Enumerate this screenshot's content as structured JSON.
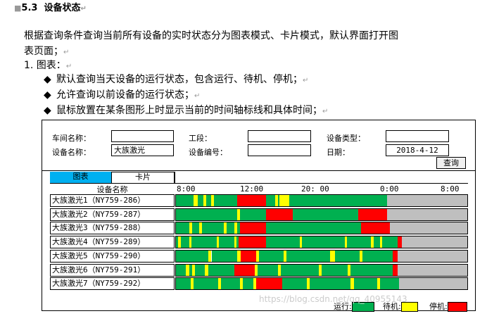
{
  "section": {
    "number": "5.3",
    "title": "设备状态"
  },
  "intro": "根据查询条件查询当前所有设备的实时状态分为图表模式、卡片模式，默认界面打开图",
  "intro2": "表页面；",
  "item1": "1. 图表：",
  "bullets": [
    "默认查询当天设备的运行状态，包含运行、待机、停机；",
    "允许查询以前设备的运行状态；",
    "鼠标放置在某条图形上时显示当前的时间轴标线和具体时间；"
  ],
  "form": {
    "workshop_label": "车间名称：",
    "workshop_value": "",
    "section_label": "工段：",
    "section_value": "",
    "type_label": "设备类型：",
    "type_value": "",
    "device_label": "设备名称：",
    "device_value": "大族激光",
    "code_label": "设备编号：",
    "code_value": "",
    "date_label": "日期：",
    "date_value": "2018-4-12",
    "query_label": "查询"
  },
  "tabs": {
    "chart": "图表",
    "card": "卡片"
  },
  "colors": {
    "running": "#00b050",
    "standby": "#ffff00",
    "stopped": "#ff0000",
    "idle": "#bfbfbf",
    "tab_active": "#00b0f0"
  },
  "chart_data": {
    "type": "timeline",
    "column_header": "设备名称",
    "time_ticks": [
      "8:00",
      "12:00",
      "20: 00",
      "0:00",
      "8:00"
    ],
    "legend": {
      "running": "运行:",
      "standby": "待机:",
      "stopped": "停机:"
    },
    "rows": [
      {
        "name": "大族激光1（NY759-286）",
        "segments": [
          {
            "s": "run",
            "f": 0,
            "t": 0.06
          },
          {
            "s": "stb",
            "f": 0.06,
            "t": 0.075
          },
          {
            "s": "run",
            "f": 0.075,
            "t": 0.095
          },
          {
            "s": "stb",
            "f": 0.095,
            "t": 0.105
          },
          {
            "s": "run",
            "f": 0.105,
            "t": 0.12
          },
          {
            "s": "stb",
            "f": 0.12,
            "t": 0.13
          },
          {
            "s": "run",
            "f": 0.13,
            "t": 0.21
          },
          {
            "s": "stp",
            "f": 0.21,
            "t": 0.31
          },
          {
            "s": "run",
            "f": 0.31,
            "t": 0.34
          },
          {
            "s": "stb",
            "f": 0.34,
            "t": 0.35
          },
          {
            "s": "run",
            "f": 0.35,
            "t": 0.355
          },
          {
            "s": "stb",
            "f": 0.355,
            "t": 0.39
          },
          {
            "s": "run",
            "f": 0.39,
            "t": 0.725
          },
          {
            "s": "idle",
            "f": 0.725,
            "t": 1
          }
        ]
      },
      {
        "name": "大族激光2（NY759-287）",
        "segments": [
          {
            "s": "run",
            "f": 0,
            "t": 0.21
          },
          {
            "s": "stb",
            "f": 0.21,
            "t": 0.22
          },
          {
            "s": "run",
            "f": 0.22,
            "t": 0.31
          },
          {
            "s": "stp",
            "f": 0.31,
            "t": 0.4
          },
          {
            "s": "run",
            "f": 0.4,
            "t": 0.625
          },
          {
            "s": "stp",
            "f": 0.625,
            "t": 0.725
          },
          {
            "s": "idle",
            "f": 0.725,
            "t": 1
          }
        ]
      },
      {
        "name": "大族激光3（NY759-288）",
        "segments": [
          {
            "s": "run",
            "f": 0,
            "t": 0.045
          },
          {
            "s": "stb",
            "f": 0.045,
            "t": 0.055
          },
          {
            "s": "run",
            "f": 0.055,
            "t": 0.08
          },
          {
            "s": "stb",
            "f": 0.08,
            "t": 0.09
          },
          {
            "s": "run",
            "f": 0.09,
            "t": 0.165
          },
          {
            "s": "stb",
            "f": 0.165,
            "t": 0.175
          },
          {
            "s": "run",
            "f": 0.175,
            "t": 0.2
          },
          {
            "s": "stb",
            "f": 0.2,
            "t": 0.21
          },
          {
            "s": "run",
            "f": 0.21,
            "t": 0.22
          },
          {
            "s": "stp",
            "f": 0.22,
            "t": 0.31
          },
          {
            "s": "run",
            "f": 0.31,
            "t": 0.635
          },
          {
            "s": "stp",
            "f": 0.635,
            "t": 0.735
          },
          {
            "s": "idle",
            "f": 0.735,
            "t": 1
          }
        ]
      },
      {
        "name": "大族激光4（NY759-289）",
        "segments": [
          {
            "s": "run",
            "f": 0,
            "t": 0.008
          },
          {
            "s": "stb",
            "f": 0.008,
            "t": 0.016
          },
          {
            "s": "run",
            "f": 0.016,
            "t": 0.045
          },
          {
            "s": "stb",
            "f": 0.045,
            "t": 0.053
          },
          {
            "s": "run",
            "f": 0.053,
            "t": 0.14
          },
          {
            "s": "stb",
            "f": 0.14,
            "t": 0.148
          },
          {
            "s": "run",
            "f": 0.148,
            "t": 0.2
          },
          {
            "s": "stb",
            "f": 0.2,
            "t": 0.208
          },
          {
            "s": "run",
            "f": 0.208,
            "t": 0.215
          },
          {
            "s": "stp",
            "f": 0.215,
            "t": 0.31
          },
          {
            "s": "run",
            "f": 0.31,
            "t": 0.425
          },
          {
            "s": "stb",
            "f": 0.425,
            "t": 0.433
          },
          {
            "s": "run",
            "f": 0.433,
            "t": 0.58
          },
          {
            "s": "stb",
            "f": 0.58,
            "t": 0.588
          },
          {
            "s": "run",
            "f": 0.588,
            "t": 0.67
          },
          {
            "s": "stb",
            "f": 0.67,
            "t": 0.678
          },
          {
            "s": "run",
            "f": 0.678,
            "t": 0.7
          },
          {
            "s": "stb",
            "f": 0.7,
            "t": 0.708
          },
          {
            "s": "run",
            "f": 0.708,
            "t": 0.76
          },
          {
            "s": "stp",
            "f": 0.76,
            "t": 0.775
          },
          {
            "s": "idle",
            "f": 0.775,
            "t": 1
          }
        ]
      },
      {
        "name": "大族激光5（NY759-290）",
        "segments": [
          {
            "s": "run",
            "f": 0,
            "t": 0.11
          },
          {
            "s": "stb",
            "f": 0.11,
            "t": 0.122
          },
          {
            "s": "run",
            "f": 0.122,
            "t": 0.21
          },
          {
            "s": "stb",
            "f": 0.21,
            "t": 0.222
          },
          {
            "s": "stp",
            "f": 0.222,
            "t": 0.275
          },
          {
            "s": "stb",
            "f": 0.275,
            "t": 0.285
          },
          {
            "s": "run",
            "f": 0.285,
            "t": 0.37
          },
          {
            "s": "stb",
            "f": 0.37,
            "t": 0.38
          },
          {
            "s": "run",
            "f": 0.38,
            "t": 0.53
          },
          {
            "s": "stb",
            "f": 0.53,
            "t": 0.545
          },
          {
            "s": "run",
            "f": 0.545,
            "t": 0.63
          },
          {
            "s": "stb",
            "f": 0.63,
            "t": 0.64
          },
          {
            "s": "run",
            "f": 0.64,
            "t": 0.745
          },
          {
            "s": "stp",
            "f": 0.745,
            "t": 0.76
          },
          {
            "s": "idle",
            "f": 0.76,
            "t": 1
          }
        ]
      },
      {
        "name": "大族激光6（NY759-291）",
        "segments": [
          {
            "s": "run",
            "f": 0,
            "t": 0.035
          },
          {
            "s": "stb",
            "f": 0.035,
            "t": 0.045
          },
          {
            "s": "run",
            "f": 0.045,
            "t": 0.055
          },
          {
            "s": "stb",
            "f": 0.055,
            "t": 0.065
          },
          {
            "s": "run",
            "f": 0.065,
            "t": 0.1
          },
          {
            "s": "stb",
            "f": 0.1,
            "t": 0.11
          },
          {
            "s": "run",
            "f": 0.11,
            "t": 0.2
          },
          {
            "s": "stp",
            "f": 0.2,
            "t": 0.27
          },
          {
            "s": "stb",
            "f": 0.27,
            "t": 0.28
          },
          {
            "s": "run",
            "f": 0.28,
            "t": 0.35
          },
          {
            "s": "stb",
            "f": 0.35,
            "t": 0.36
          },
          {
            "s": "run",
            "f": 0.36,
            "t": 0.49
          },
          {
            "s": "stb",
            "f": 0.49,
            "t": 0.5
          },
          {
            "s": "run",
            "f": 0.5,
            "t": 0.59
          },
          {
            "s": "stb",
            "f": 0.59,
            "t": 0.6
          },
          {
            "s": "run",
            "f": 0.6,
            "t": 0.745
          },
          {
            "s": "stp",
            "f": 0.745,
            "t": 0.76
          },
          {
            "s": "idle",
            "f": 0.76,
            "t": 1
          }
        ]
      },
      {
        "name": "大族激光7（NY759-292）",
        "segments": [
          {
            "s": "run",
            "f": 0,
            "t": 0.05
          },
          {
            "s": "stb",
            "f": 0.05,
            "t": 0.06
          },
          {
            "s": "run",
            "f": 0.06,
            "t": 0.145
          },
          {
            "s": "stb",
            "f": 0.145,
            "t": 0.155
          },
          {
            "s": "run",
            "f": 0.155,
            "t": 0.22
          },
          {
            "s": "stb",
            "f": 0.22,
            "t": 0.23
          },
          {
            "s": "run",
            "f": 0.23,
            "t": 0.265
          },
          {
            "s": "stb",
            "f": 0.265,
            "t": 0.275
          },
          {
            "s": "stp",
            "f": 0.275,
            "t": 0.365
          },
          {
            "s": "run",
            "f": 0.365,
            "t": 0.45
          },
          {
            "s": "stb",
            "f": 0.45,
            "t": 0.46
          },
          {
            "s": "run",
            "f": 0.46,
            "t": 0.6
          },
          {
            "s": "stb",
            "f": 0.6,
            "t": 0.61
          },
          {
            "s": "run",
            "f": 0.61,
            "t": 0.69
          },
          {
            "s": "stb",
            "f": 0.69,
            "t": 0.7
          },
          {
            "s": "run",
            "f": 0.7,
            "t": 0.765
          },
          {
            "s": "idle",
            "f": 0.765,
            "t": 1
          }
        ]
      }
    ]
  },
  "watermark": "https://blog.csdn.net/qq_40955143"
}
